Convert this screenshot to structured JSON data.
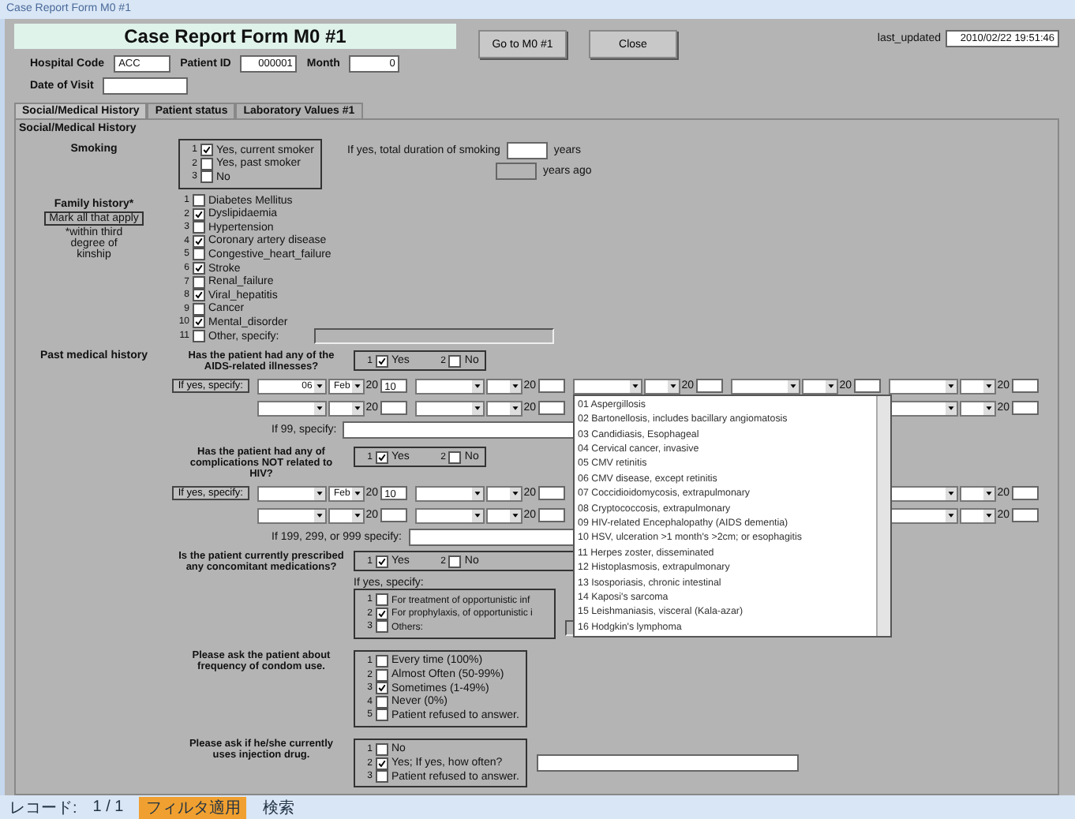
{
  "window": {
    "title": "Case Report Form M0 #1"
  },
  "header": {
    "title": "Case Report Form M0 #1",
    "buttons": [
      "Go to M0 #1",
      "Close"
    ],
    "last_updated_label": "last_updated",
    "last_updated": "2010/02/22 19:51:46"
  },
  "fields": [
    {
      "label": "Hospital Code",
      "value": "ACC"
    },
    {
      "label": "Patient ID",
      "value": "000001"
    },
    {
      "label": "Month",
      "value": "0"
    }
  ],
  "visit": {
    "label": "Date of Visit"
  },
  "tabs": [
    {
      "label": "Social/Medical History",
      "selected": true
    },
    {
      "label": "Patient status",
      "selected": false
    },
    {
      "label": "Laboratory Values #1",
      "selected": false
    }
  ],
  "section_title": "Social/Medical History",
  "smoking": {
    "label": "Smoking",
    "options": [
      {
        "num": "1",
        "text": "Yes, current smoker",
        "checked": true
      },
      {
        "num": "2",
        "text": "Yes, past smoker",
        "checked": false
      },
      {
        "num": "3",
        "text": "No",
        "checked": false
      }
    ],
    "duration_label": "If yes, total duration of smoking",
    "duration_unit": "years",
    "ago_unit": "years ago"
  },
  "family": {
    "label": "Family history*",
    "hint": "Mark all that apply",
    "note": "*within third degree of kinship",
    "items": [
      {
        "num": "1",
        "text": "Diabetes Mellitus",
        "checked": false
      },
      {
        "num": "2",
        "text": "Dyslipidaemia",
        "checked": true
      },
      {
        "num": "3",
        "text": "Hypertension",
        "checked": false
      },
      {
        "num": "4",
        "text": "Coronary artery disease",
        "checked": true
      },
      {
        "num": "5",
        "text": "Congestive_heart_failure",
        "checked": false
      },
      {
        "num": "6",
        "text": "Stroke",
        "checked": true
      },
      {
        "num": "7",
        "text": "Renal_failure",
        "checked": false
      },
      {
        "num": "8",
        "text": "Viral_hepatitis",
        "checked": true
      },
      {
        "num": "9",
        "text": "Cancer",
        "checked": false
      },
      {
        "num": "10",
        "text": "Mental_disorder",
        "checked": true
      },
      {
        "num": "11",
        "text": "Other, specify:",
        "checked": false
      }
    ]
  },
  "aids": {
    "section_label": "Past medical history",
    "question": "Has the patient had any of the AIDS-related illnesses?",
    "answers": [
      {
        "num": "1",
        "text": "Yes",
        "checked": true
      },
      {
        "num": "2",
        "text": "No",
        "checked": false
      }
    ],
    "specify_button": "If yes, specify:",
    "rows": [
      [
        {
          "illness": "06",
          "month": "Feb",
          "year_prefix": "20",
          "year": "10"
        },
        {
          "year_prefix": "20"
        },
        {
          "year_prefix": "20",
          "open": true
        },
        {
          "year_prefix": "20"
        },
        {
          "year_prefix": "20"
        }
      ],
      [
        {
          "year_prefix": "20"
        },
        {
          "year_prefix": "20"
        },
        {},
        {},
        {
          "year_prefix": "20"
        }
      ]
    ],
    "other_label": "If 99, specify:"
  },
  "complications": {
    "question": "Has the patient had any of complications NOT related to HIV?",
    "answers": [
      {
        "num": "1",
        "text": "Yes",
        "checked": true
      },
      {
        "num": "2",
        "text": "No",
        "checked": false
      }
    ],
    "specify_button": "If yes, specify:",
    "rows": [
      [
        {
          "month": "Feb",
          "year_prefix": "20",
          "year": "10"
        },
        {
          "year_prefix": "20"
        },
        {},
        {},
        {
          "year_prefix": "20"
        }
      ],
      [
        {
          "year_prefix": "20"
        },
        {
          "year_prefix": "20"
        },
        {},
        {},
        {
          "year_prefix": "20"
        }
      ]
    ],
    "other_label": "If 199, 299, or 999 specify:"
  },
  "dropdown": {
    "items": [
      "01 Aspergillosis",
      "02 Bartonellosis, includes bacillary angiomatosis",
      "03 Candidiasis, Esophageal",
      "04 Cervical cancer, invasive",
      "05 CMV retinitis",
      "06 CMV disease, except retinitis",
      "07 Coccidioidomycosis, extrapulmonary",
      "08 Cryptococcosis, extrapulmonary",
      "09 HIV-related Encephalopathy (AIDS dementia)",
      "10 HSV, ulceration >1 month's >2cm; or esophagitis",
      "11 Herpes zoster, disseminated",
      "12 Histoplasmosis, extrapulmonary",
      "13 Isosporiasis, chronic intestinal",
      "14 Kaposi's sarcoma",
      "15 Leishmaniasis, visceral (Kala-azar)",
      "16 Hodgkin's lymphoma"
    ]
  },
  "medications": {
    "question": "Is the patient currently prescribed any concomitant medications?",
    "answers": [
      {
        "num": "1",
        "text": "Yes",
        "checked": true
      },
      {
        "num": "2",
        "text": "No",
        "checked": false
      }
    ],
    "specify_label": "If yes, specify:",
    "options": [
      {
        "num": "1",
        "text": "For treatment of opportunistic inf",
        "checked": false
      },
      {
        "num": "2",
        "text": "For prophylaxis, of opportunistic i",
        "checked": true
      },
      {
        "num": "3",
        "text": "Others:",
        "checked": false
      }
    ]
  },
  "condom": {
    "question": "Please ask the patient about frequency of condom use.",
    "options": [
      {
        "num": "1",
        "text": "Every time (100%)",
        "checked": false
      },
      {
        "num": "2",
        "text": "Almost Often (50-99%)",
        "checked": false
      },
      {
        "num": "3",
        "text": "Sometimes (1-49%)",
        "checked": true
      },
      {
        "num": "4",
        "text": "Never (0%)",
        "checked": false
      },
      {
        "num": "5",
        "text": "Patient refused to answer.",
        "checked": false
      }
    ]
  },
  "injection": {
    "question": "Please ask if he/she currently uses injection drug.",
    "options": [
      {
        "num": "1",
        "text": "No",
        "checked": false
      },
      {
        "num": "2",
        "text": "Yes; If yes, how often?",
        "checked": true
      },
      {
        "num": "3",
        "text": "Patient refused to answer.",
        "checked": false
      }
    ]
  },
  "status_bar": {
    "record_label": "レコード:",
    "position": "1 / 1",
    "filter": "フィルタ適用",
    "search": "検索"
  }
}
